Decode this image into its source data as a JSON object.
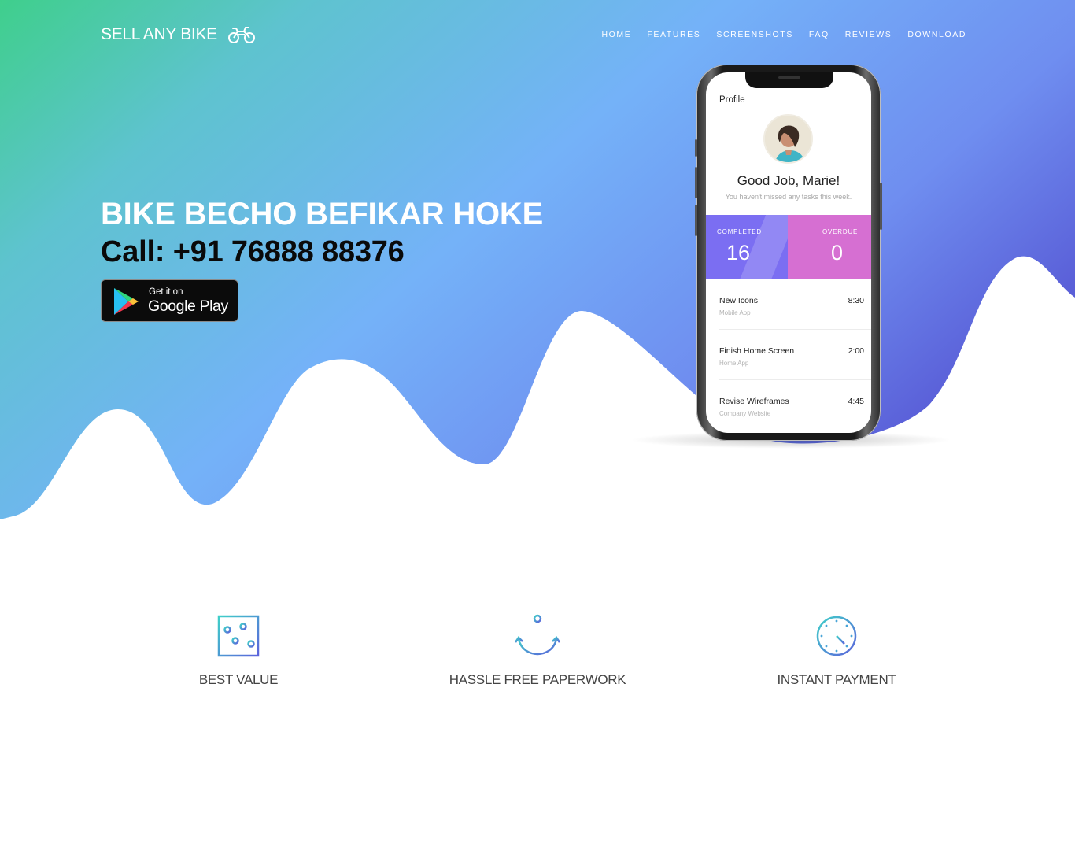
{
  "brand": {
    "name": "SELL ANY BIKE",
    "icon": "motorcycle-icon"
  },
  "nav": {
    "items": [
      "HOME",
      "FEATURES",
      "SCREENSHOTS",
      "FAQ",
      "REVIEWS",
      "DOWNLOAD"
    ]
  },
  "hero": {
    "headline": "BIKE BECHO BEFIKAR HOKE",
    "phone_line": "Call: +91 76888 88376",
    "gradient": [
      "#3ecf8e",
      "#74b3f5",
      "#5661d6"
    ],
    "store_badge": {
      "small": "Get it on",
      "big": "Google Play",
      "icon": "google-play-icon"
    }
  },
  "phone_screen": {
    "title": "Profile",
    "greeting": "Good Job, Marie!",
    "subtitle": "You haven't missed any tasks this week.",
    "stats": [
      {
        "label": "COMPLETED",
        "value": "16",
        "color": "#7b6ef2"
      },
      {
        "label": "OVERDUE",
        "value": "0",
        "color": "#d66fd2"
      }
    ],
    "tasks": [
      {
        "title": "New Icons",
        "sub": "Mobile App",
        "time": "8:30"
      },
      {
        "title": "Finish Home Screen",
        "sub": "Home App",
        "time": "2:00"
      },
      {
        "title": "Revise Wireframes",
        "sub": "Company Website",
        "time": "4:45"
      }
    ]
  },
  "features": [
    {
      "label": "BEST VALUE",
      "icon": "sliders-icon"
    },
    {
      "label": "HASSLE FREE PAPERWORK",
      "icon": "anchor-icon"
    },
    {
      "label": "INSTANT PAYMENT",
      "icon": "clock-icon"
    }
  ]
}
